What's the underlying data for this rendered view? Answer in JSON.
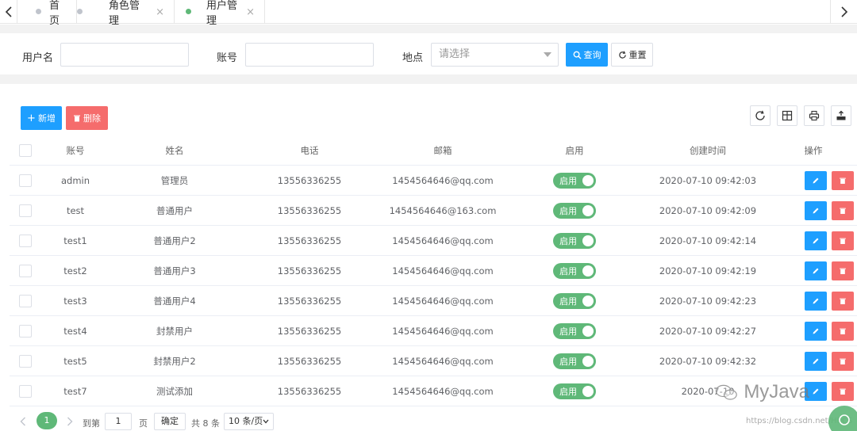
{
  "tabs": [
    {
      "label": "首页",
      "active": false,
      "closable": false
    },
    {
      "label": "角色管理",
      "active": false,
      "closable": true
    },
    {
      "label": "用户管理",
      "active": true,
      "closable": true
    }
  ],
  "tab_close_glyph": "×",
  "search": {
    "username_label": "用户名",
    "account_label": "账号",
    "location_label": "地点",
    "location_placeholder": "请选择",
    "query_label": "查询",
    "reset_label": "重置"
  },
  "toolbar": {
    "add_label": "新增",
    "delete_label": "删除"
  },
  "table": {
    "headers": [
      "账号",
      "姓名",
      "电话",
      "邮箱",
      "启用",
      "创建时间",
      "操作"
    ],
    "rows": [
      {
        "account": "admin",
        "name": "管理员",
        "phone": "13556336255",
        "email": "1454564646@qq.com",
        "enabled": "启用",
        "created": "2020-07-10 09:42:03"
      },
      {
        "account": "test",
        "name": "普通用户",
        "phone": "13556336255",
        "email": "1454564646@163.com",
        "enabled": "启用",
        "created": "2020-07-10 09:42:09"
      },
      {
        "account": "test1",
        "name": "普通用户2",
        "phone": "13556336255",
        "email": "1454564646@qq.com",
        "enabled": "启用",
        "created": "2020-07-10 09:42:14"
      },
      {
        "account": "test2",
        "name": "普通用户3",
        "phone": "13556336255",
        "email": "1454564646@qq.com",
        "enabled": "启用",
        "created": "2020-07-10 09:42:19"
      },
      {
        "account": "test3",
        "name": "普通用户4",
        "phone": "13556336255",
        "email": "1454564646@qq.com",
        "enabled": "启用",
        "created": "2020-07-10 09:42:23"
      },
      {
        "account": "test4",
        "name": "封禁用户",
        "phone": "13556336255",
        "email": "1454564646@qq.com",
        "enabled": "启用",
        "created": "2020-07-10 09:42:27"
      },
      {
        "account": "test5",
        "name": "封禁用户2",
        "phone": "13556336255",
        "email": "1454564646@qq.com",
        "enabled": "启用",
        "created": "2020-07-10 09:42:32"
      },
      {
        "account": "test7",
        "name": "测试添加",
        "phone": "13556336255",
        "email": "1454564646@qq.com",
        "enabled": "启用",
        "created": "2020-07-10"
      }
    ]
  },
  "pagination": {
    "current_page": "1",
    "goto_label": "到第",
    "goto_value": "1",
    "page_unit": "页",
    "confirm_label": "确定",
    "total_label": "共 8 条",
    "page_size": "10 条/页"
  },
  "watermark": {
    "text": "MyJava",
    "url": "https://blog.csdn.net/HRCS"
  },
  "colors": {
    "primary": "#1e9fff",
    "danger": "#f56c6c",
    "success": "#5fb878"
  }
}
